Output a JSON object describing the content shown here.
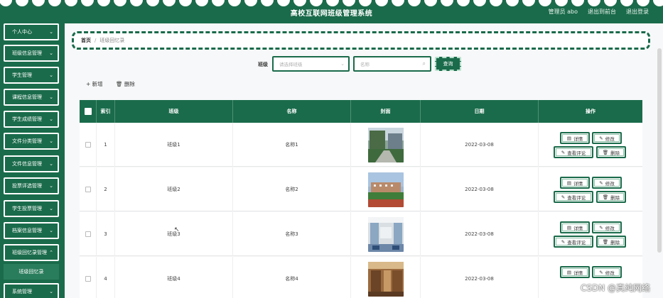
{
  "header": {
    "title": "高校互联网班级管理系统",
    "user_label": "管理员 abo",
    "front_link": "退出到前台",
    "logout_link": "退出登录"
  },
  "sidebar": {
    "items": [
      {
        "label": "个人中心"
      },
      {
        "label": "班级信息管理"
      },
      {
        "label": "学生管理"
      },
      {
        "label": "课程信息管理"
      },
      {
        "label": "学生成绩管理"
      },
      {
        "label": "文件分类管理"
      },
      {
        "label": "文件信息管理"
      },
      {
        "label": "投票评选管理"
      },
      {
        "label": "学生投票管理"
      },
      {
        "label": "档案信息管理"
      },
      {
        "label": "班级回忆录管理"
      },
      {
        "label": "系统管理"
      }
    ],
    "active_sub": "班级回忆录"
  },
  "breadcrumb": {
    "home": "首页",
    "sep": "/",
    "current": "班级回忆录"
  },
  "search": {
    "label": "班级",
    "select_placeholder": "请选择班级",
    "input_placeholder": "名称",
    "button": "查询"
  },
  "actions": {
    "add": "新增",
    "delete": "删除"
  },
  "table": {
    "headers": {
      "index": "索引",
      "class": "班级",
      "name": "名称",
      "cover": "封面",
      "date": "日期",
      "ops": "操作"
    },
    "rows": [
      {
        "index": "1",
        "class": "班级1",
        "name": "名称1",
        "date": "2022-03-08"
      },
      {
        "index": "2",
        "class": "班级2",
        "name": "名称2",
        "date": "2022-03-08"
      },
      {
        "index": "3",
        "class": "班级3",
        "name": "名称3",
        "date": "2022-03-08"
      },
      {
        "index": "4",
        "class": "班级4",
        "name": "名称4",
        "date": "2022-03-08"
      }
    ],
    "op_labels": {
      "detail": "详情",
      "edit": "修改",
      "comments": "查看评论",
      "delete": "删除"
    }
  },
  "watermark": "CSDN @真纯网络",
  "colors": {
    "primary": "#1a6b4b",
    "background": "#f7f8f9"
  }
}
